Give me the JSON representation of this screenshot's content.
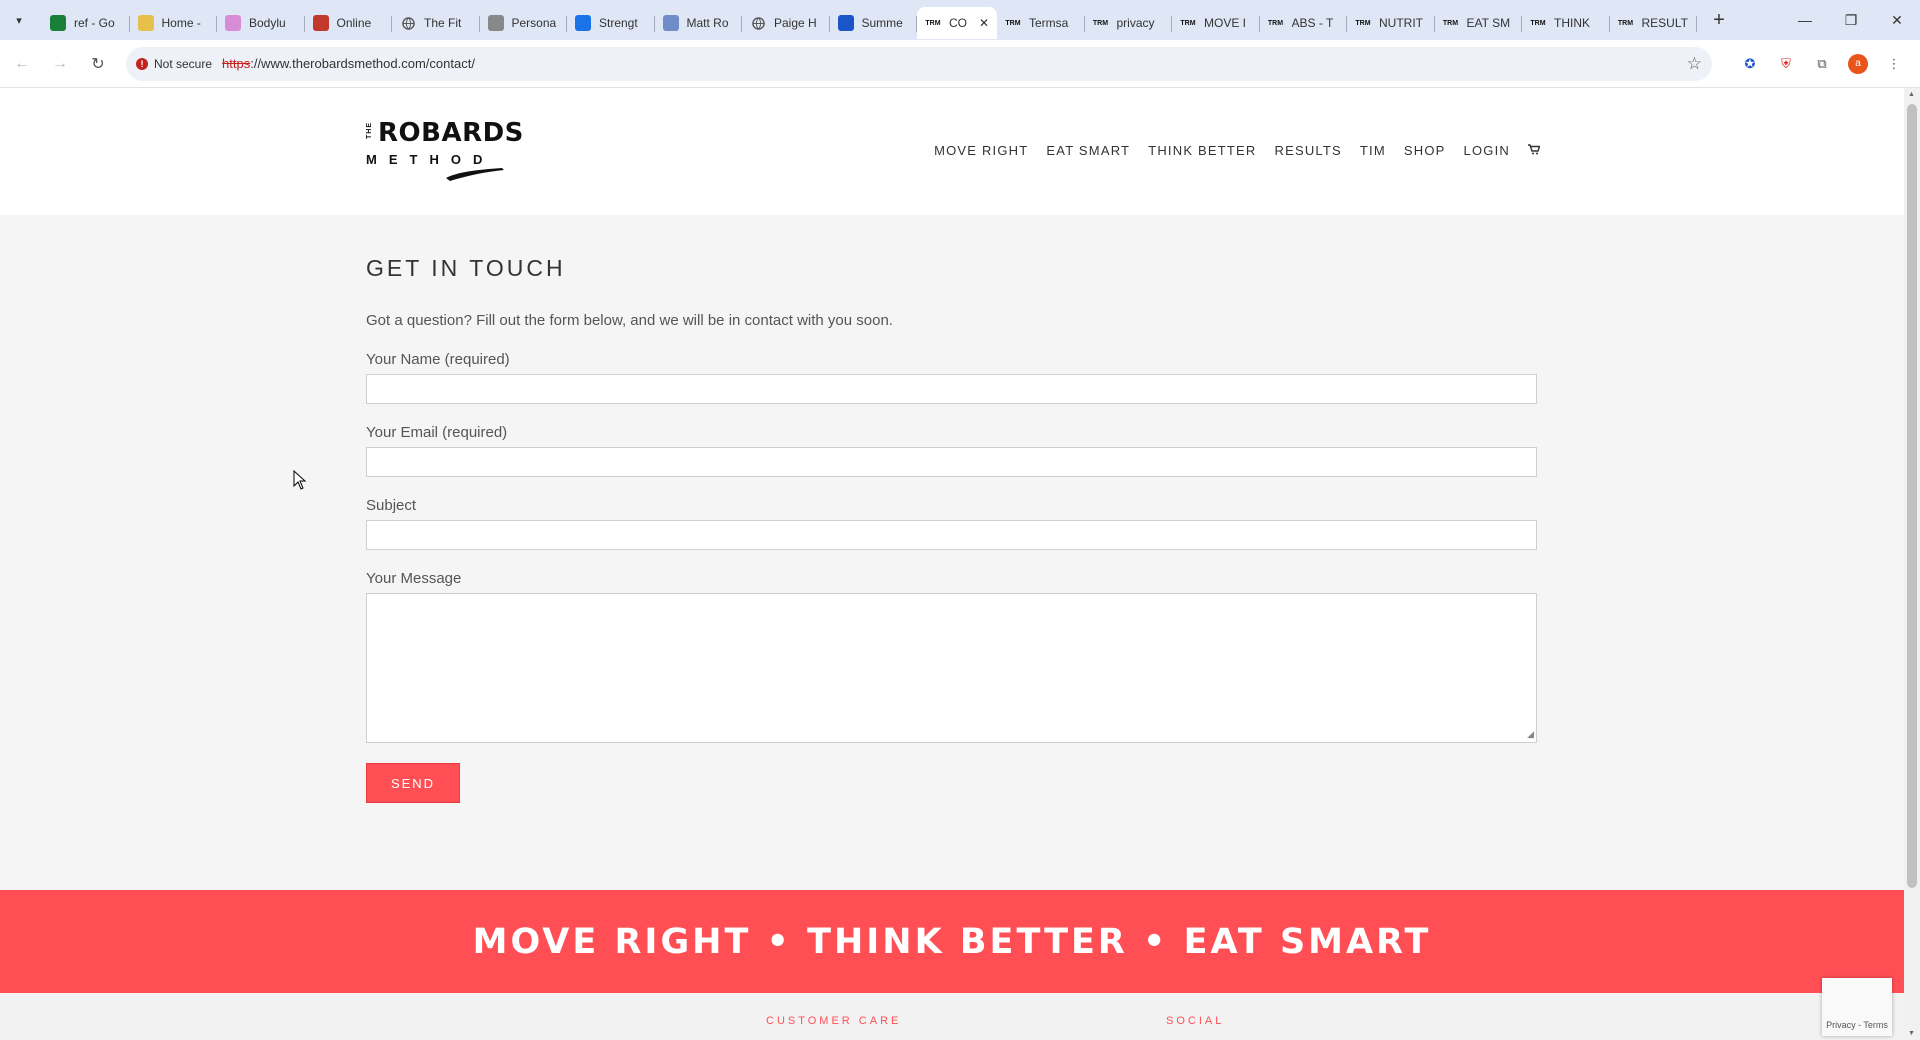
{
  "browser": {
    "tabs": [
      {
        "label": "ref - Go",
        "icon": "sheets-icon",
        "color": "#188038"
      },
      {
        "label": "Home -",
        "icon": "home-favicon",
        "color": "#e6c04a"
      },
      {
        "label": "Bodylu",
        "icon": "bodylura-favicon",
        "color": "#d98cd6"
      },
      {
        "label": "Online",
        "icon": "online-favicon",
        "color": "#c0392b"
      },
      {
        "label": "The Fit",
        "icon": "globe-icon",
        "color": "#555555"
      },
      {
        "label": "Persona",
        "icon": "persona-favicon",
        "color": "#888888"
      },
      {
        "label": "Strengt",
        "icon": "strength-favicon",
        "color": "#1a73e8"
      },
      {
        "label": "Matt Ro",
        "icon": "mattro-favicon",
        "color": "#6f8cc9"
      },
      {
        "label": "Paige H",
        "icon": "globe-icon",
        "color": "#555555"
      },
      {
        "label": "Summe",
        "icon": "summer-favicon",
        "color": "#1a56c9"
      },
      {
        "label": "CO",
        "icon": "trm-favicon",
        "active": true,
        "color": "#111111"
      },
      {
        "label": "Termsa",
        "icon": "trm-favicon",
        "color": "#111111"
      },
      {
        "label": "privacy",
        "icon": "trm-favicon",
        "color": "#111111"
      },
      {
        "label": "MOVE I",
        "icon": "trm-favicon",
        "color": "#111111"
      },
      {
        "label": "ABS - T",
        "icon": "trm-favicon",
        "color": "#111111"
      },
      {
        "label": "NUTRIT",
        "icon": "trm-favicon",
        "color": "#111111"
      },
      {
        "label": "EAT SM",
        "icon": "trm-favicon",
        "color": "#111111"
      },
      {
        "label": "THINK",
        "icon": "trm-favicon",
        "color": "#111111"
      },
      {
        "label": "RESULT",
        "icon": "trm-favicon",
        "color": "#111111"
      }
    ],
    "favicon_text": "TRM",
    "not_secure_label": "Not secure",
    "url_scheme": "https",
    "url_rest": "://www.therobardsmethod.com/contact/",
    "profile_initial": "a"
  },
  "site": {
    "logo": {
      "the": "THE",
      "brand": "ROBARDS",
      "method": "METHOD"
    },
    "nav": [
      {
        "label": "MOVE RIGHT"
      },
      {
        "label": "EAT SMART"
      },
      {
        "label": "THINK BETTER"
      },
      {
        "label": "RESULTS"
      },
      {
        "label": "TIM"
      },
      {
        "label": "SHOP"
      },
      {
        "label": "LOGIN"
      }
    ],
    "cart_icon": "cart-icon"
  },
  "contact": {
    "heading": "GET IN TOUCH",
    "intro": "Got a question?  Fill out the form below, and we will be in contact with you soon.",
    "name_label": "Your Name (required)",
    "name_value": "",
    "email_label": "Your Email (required)",
    "email_value": "",
    "subject_label": "Subject",
    "subject_value": "",
    "message_label": "Your Message",
    "message_value": "",
    "send_label": "SEND"
  },
  "banner": {
    "text": "MOVE RIGHT • THINK BETTER • EAT SMART"
  },
  "footer": {
    "customer_care": "CUSTOMER CARE",
    "social": "SOCIAL"
  },
  "recaptcha": {
    "text": "Privacy - Terms"
  },
  "colors": {
    "accent": "#ff4f55",
    "tabstrip": "#dfe6f5"
  }
}
